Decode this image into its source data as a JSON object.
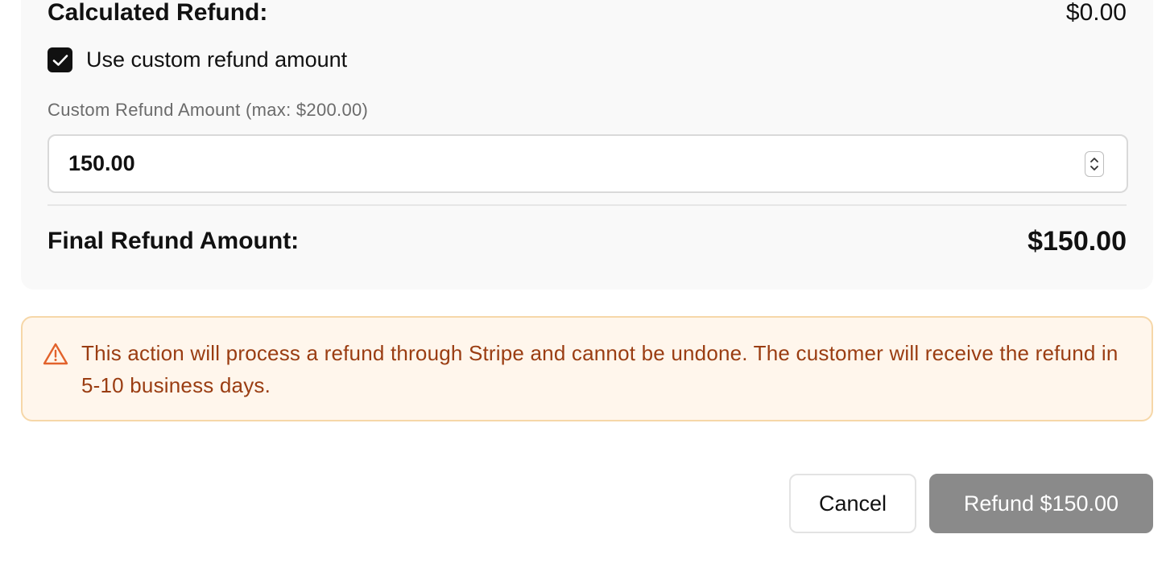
{
  "summary": {
    "calculated_label": "Calculated Refund:",
    "calculated_value": "$0.00",
    "custom_checkbox_label": "Use custom refund amount",
    "custom_checkbox_checked": true,
    "custom_amount_label": "Custom Refund Amount (max: $200.00)",
    "custom_amount_value": "150.00",
    "final_label": "Final Refund Amount:",
    "final_value": "$150.00"
  },
  "warning": {
    "icon": "warning-triangle-icon",
    "text": "This action will process a refund through Stripe and cannot be undone. The customer will receive the refund in 5-10 business days."
  },
  "footer": {
    "cancel_label": "Cancel",
    "refund_label": "Refund $150.00"
  },
  "colors": {
    "card_background": "#f9f9f9",
    "warning_background": "#fff6ec",
    "warning_border": "#f6d7a8",
    "warning_text": "#9a3d12",
    "warning_icon": "#e2622b",
    "refund_button_disabled": "#8a8a8a"
  }
}
